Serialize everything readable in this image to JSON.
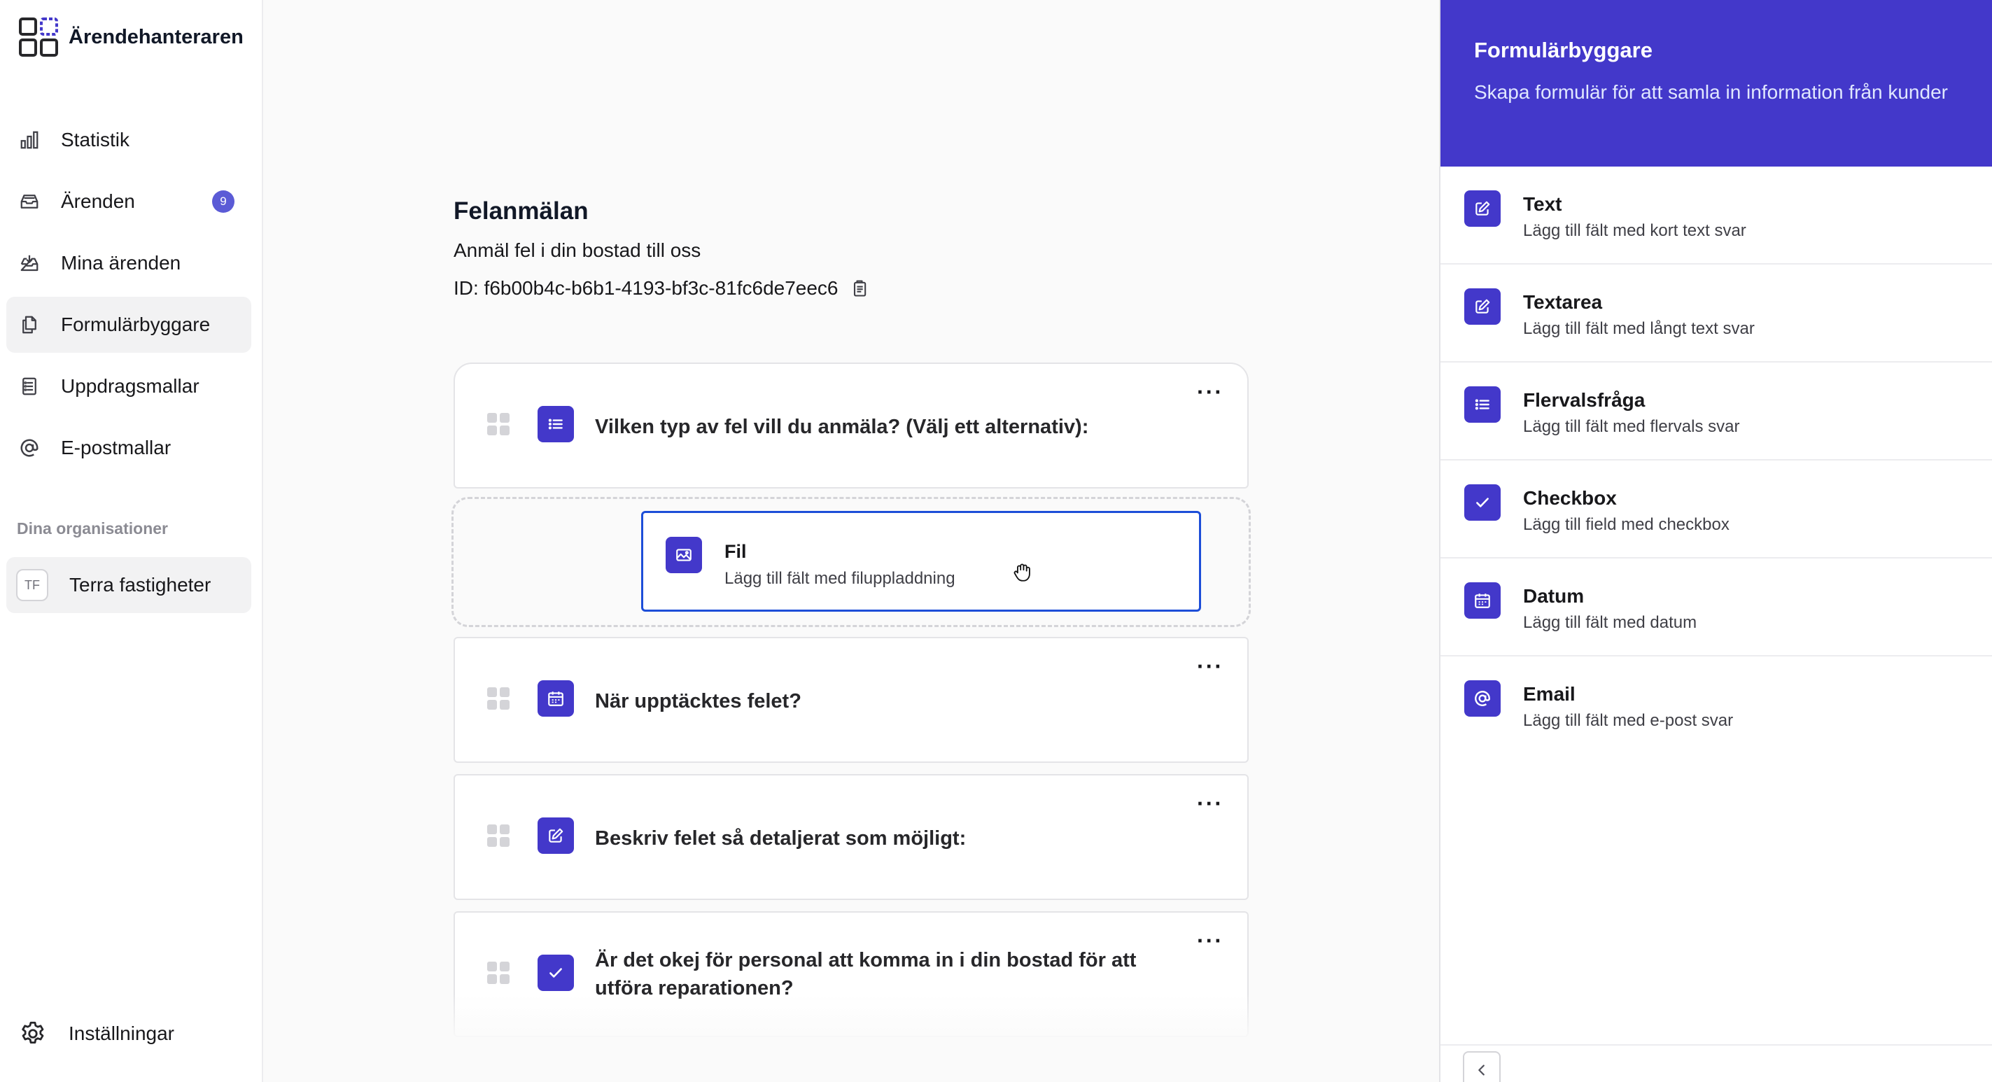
{
  "app": {
    "title": "Ärendehanteraren"
  },
  "sidebar": {
    "items": [
      {
        "label": "Statistik",
        "icon": "bar-chart-icon"
      },
      {
        "label": "Ärenden",
        "icon": "inbox-stack-icon",
        "badge": "9"
      },
      {
        "label": "Mina ärenden",
        "icon": "inbox-arrow-icon"
      },
      {
        "label": "Formulärbyggare",
        "icon": "document-duplicate-icon",
        "active": true
      },
      {
        "label": "Uppdragsmallar",
        "icon": "clipboard-list-icon"
      },
      {
        "label": "E-postmallar",
        "icon": "at-sign-icon"
      }
    ],
    "org_heading": "Dina organisationer",
    "org": {
      "initials": "TF",
      "name": "Terra fastigheter"
    },
    "settings_label": "Inställningar"
  },
  "form": {
    "title": "Felanmälan",
    "description": "Anmäl fel i din bostad till oss",
    "id_text": "ID: f6b00b4c-b6b1-4193-bf3c-81fc6de7eec6",
    "fields": [
      {
        "label": "Vilken typ av fel vill du anmäla? (Välj ett alternativ):",
        "icon": "list-icon"
      },
      {
        "label": "När upptäcktes felet?",
        "icon": "calendar-icon"
      },
      {
        "label": "Beskriv felet så detaljerat som möjligt:",
        "icon": "pencil-square-icon"
      },
      {
        "label": "Är det okej för personal att komma in i din bostad för att utföra reparationen?",
        "icon": "check-icon"
      }
    ],
    "menu_glyph": "···"
  },
  "drag_preview": {
    "title": "Fil",
    "subtitle": "Lägg till fält med filuppladdning",
    "icon": "image-icon"
  },
  "panel": {
    "title": "Formulärbyggare",
    "subtitle": "Skapa formulär för att samla in information från kunder",
    "items": [
      {
        "title": "Text",
        "subtitle": "Lägg till fält med kort text svar",
        "icon": "pencil-square-icon"
      },
      {
        "title": "Textarea",
        "subtitle": "Lägg till fält med långt text svar",
        "icon": "pencil-square-icon"
      },
      {
        "title": "Flervalsfråga",
        "subtitle": "Lägg till fält med flervals svar",
        "icon": "list-icon"
      },
      {
        "title": "Checkbox",
        "subtitle": "Lägg till field med checkbox",
        "icon": "check-icon"
      },
      {
        "title": "Datum",
        "subtitle": "Lägg till fält med datum",
        "icon": "calendar-icon"
      },
      {
        "title": "Email",
        "subtitle": "Lägg till fält med e-post svar",
        "icon": "at-sign-icon"
      }
    ]
  },
  "colors": {
    "accent": "#4338ca",
    "badge": "#5b5bd6",
    "drag_border": "#1d4ed8"
  }
}
